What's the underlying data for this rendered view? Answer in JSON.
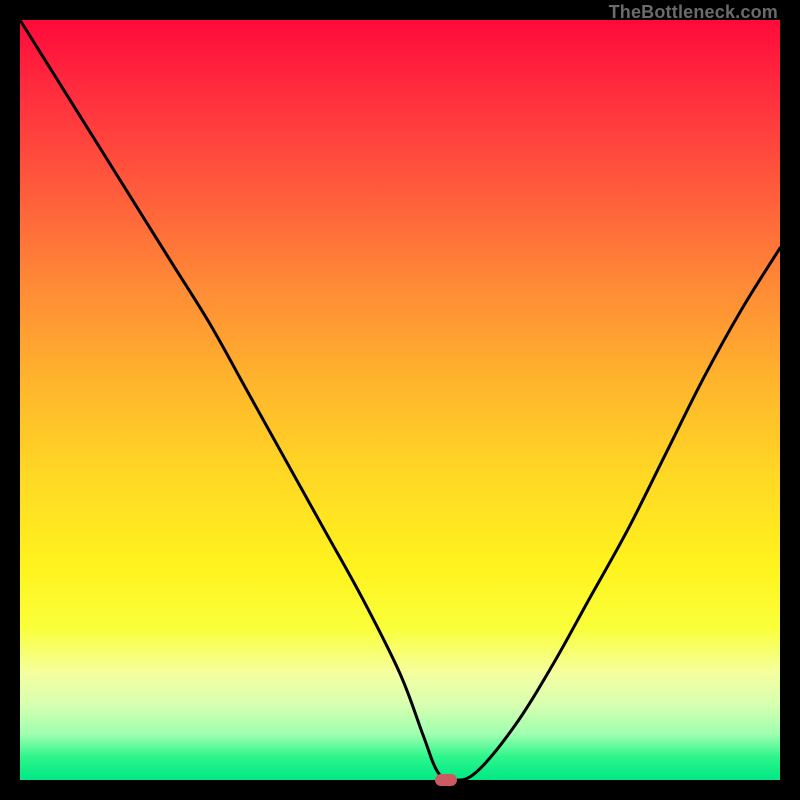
{
  "watermark": "TheBottleneck.com",
  "chart_data": {
    "type": "line",
    "title": "",
    "xlabel": "",
    "ylabel": "",
    "xlim": [
      0,
      100
    ],
    "ylim": [
      0,
      100
    ],
    "grid": false,
    "legend": false,
    "series": [
      {
        "name": "bottleneck-curve",
        "x": [
          0,
          5,
          10,
          15,
          20,
          25,
          30,
          35,
          40,
          45,
          50,
          53,
          55,
          57,
          60,
          65,
          70,
          75,
          80,
          85,
          90,
          95,
          100
        ],
        "values": [
          100,
          92,
          84,
          76,
          68,
          60,
          51,
          42,
          33,
          24,
          14,
          6,
          1,
          0,
          1,
          7,
          15,
          24,
          33,
          43,
          53,
          62,
          70
        ]
      }
    ],
    "marker": {
      "x": 56,
      "y": 0
    },
    "background_gradient": {
      "top": "#ff0a3a",
      "mid": "#ffe21e",
      "bottom": "#00e886"
    }
  }
}
